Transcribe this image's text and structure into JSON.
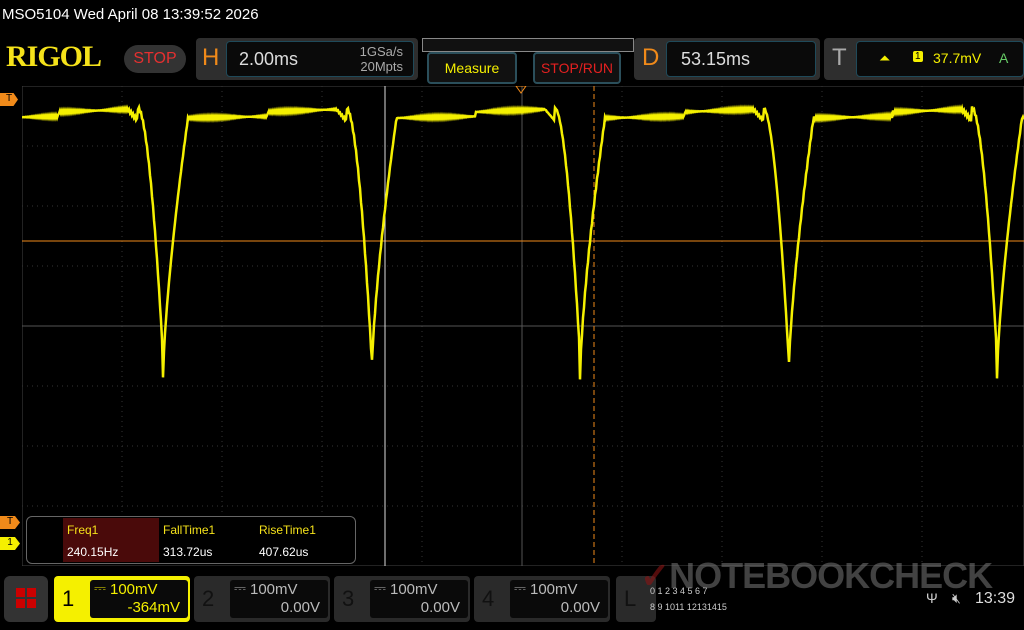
{
  "header": {
    "title": "MSO5104  Wed April 08 13:39:52 2026",
    "logo": "RIGOL",
    "run_state": "STOP"
  },
  "horizontal": {
    "label": "H",
    "timebase": "2.00ms",
    "sample_rate": "1GSa/s",
    "memory_depth": "20Mpts"
  },
  "buttons": {
    "measure": "Measure",
    "stop_run": "STOP/RUN"
  },
  "delay": {
    "label": "D",
    "value": "53.15ms"
  },
  "trigger": {
    "label": "T",
    "slope_icon": "rising-edge-icon",
    "source": "1",
    "level": "37.7mV",
    "mode": "A"
  },
  "measurements": [
    {
      "name": "Freq1",
      "value": "240.15Hz"
    },
    {
      "name": "FallTime1",
      "value": "313.72us"
    },
    {
      "name": "RiseTime1",
      "value": "407.62us"
    }
  ],
  "markers": {
    "trigger": "T",
    "channel": "1"
  },
  "channels": [
    {
      "num": "1",
      "scale": "100mV",
      "offset": "-364mV",
      "active": true
    },
    {
      "num": "2",
      "scale": "100mV",
      "offset": "0.00V"
    },
    {
      "num": "3",
      "scale": "100mV",
      "offset": "0.00V"
    },
    {
      "num": "4",
      "scale": "100mV",
      "offset": "0.00V"
    }
  ],
  "logic": {
    "label": "L",
    "row1": "0 1 2 3 4 5 6 7",
    "row2": "8 9 1011 12131415"
  },
  "status": {
    "time": "13:39",
    "usb_icon": "usb-icon",
    "sound_icon": "mute-icon"
  },
  "watermark": "NOTEBOOKCHECK",
  "colors": {
    "ch1": "#f5f000",
    "trigger": "#f08a1a",
    "accent": "#f08a1a"
  }
}
